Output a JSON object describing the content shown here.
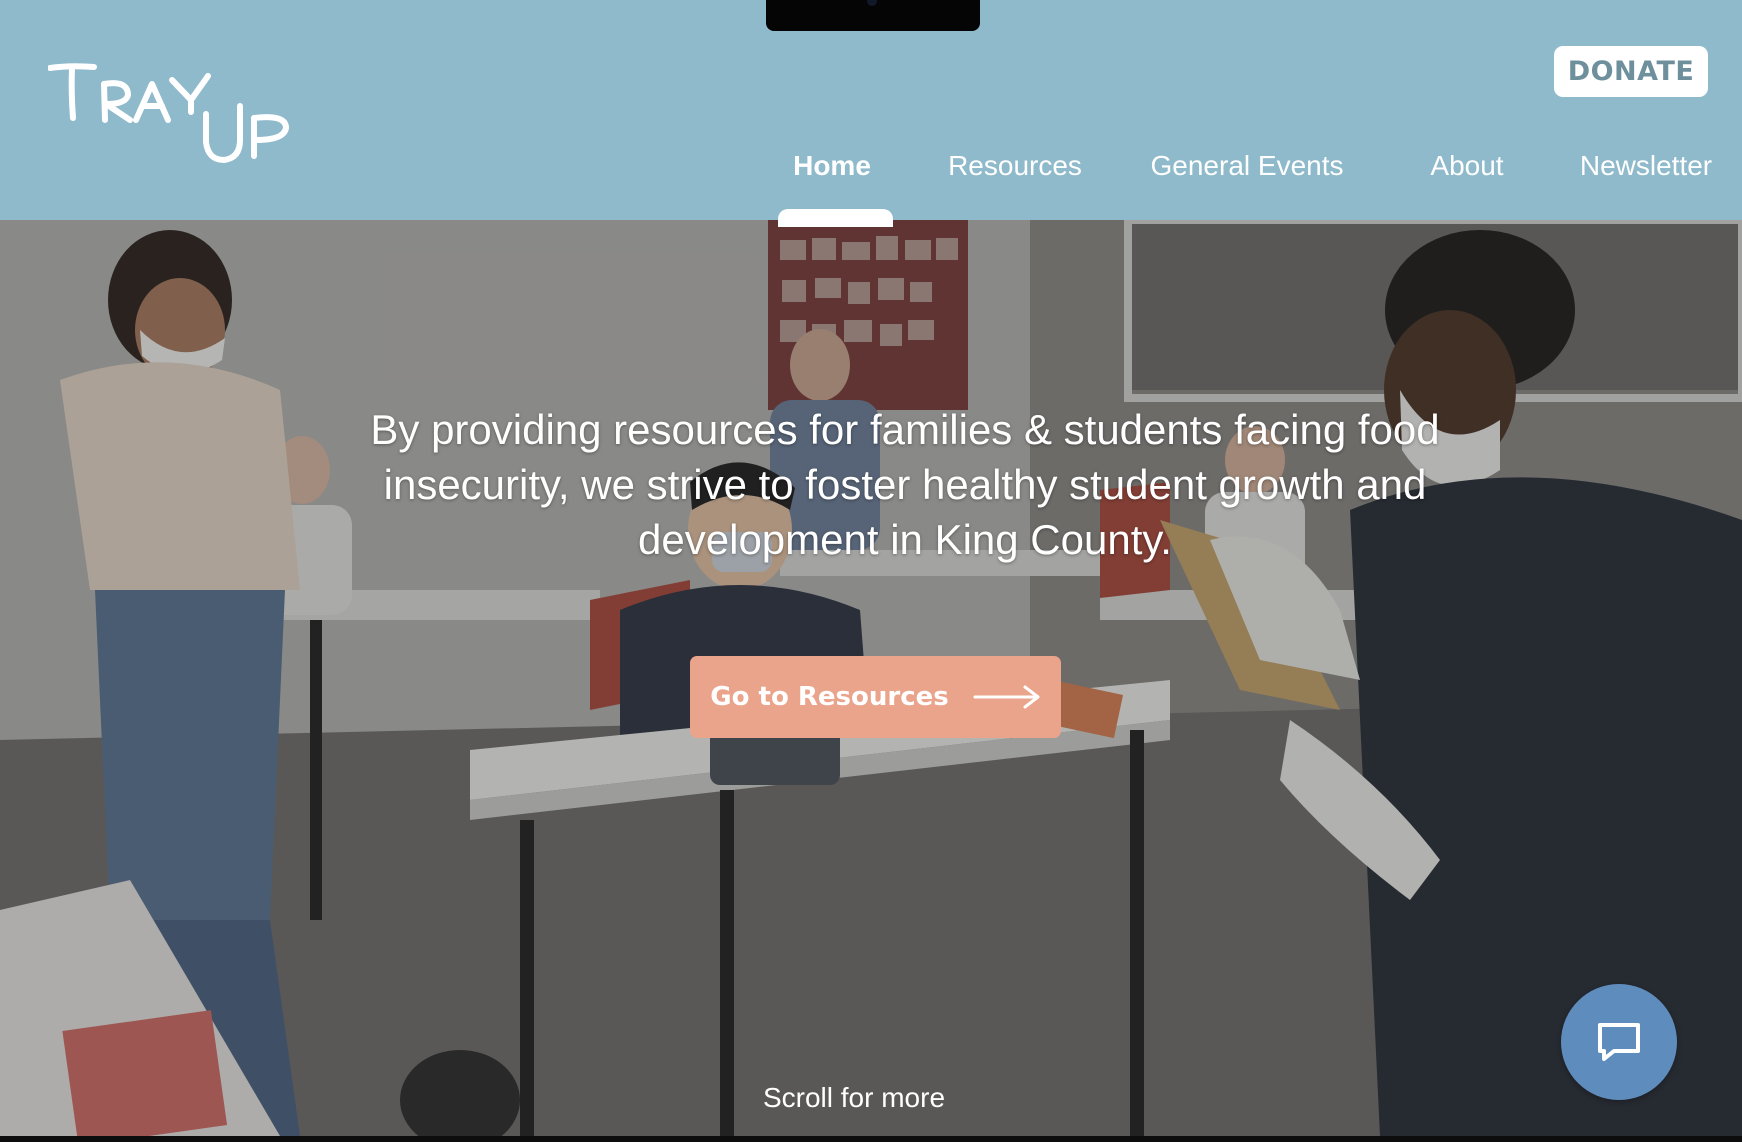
{
  "header": {
    "logo_text": "TRAY UP",
    "donate_label": "DONATE",
    "nav": [
      {
        "label": "Home",
        "active": true
      },
      {
        "label": "Resources",
        "active": false
      },
      {
        "label": "General Events",
        "active": false
      },
      {
        "label": "About",
        "active": false
      },
      {
        "label": "Newsletter",
        "active": false
      }
    ]
  },
  "hero": {
    "headline": "By providing resources for families & students facing food insecurity, we strive to foster healthy student growth and development in King County.",
    "cta_label": "Go to Resources",
    "cta_icon": "arrow-right-icon",
    "scroll_label": "Scroll for more",
    "background": "classroom-photo"
  },
  "chat": {
    "icon": "chat-bubble-icon"
  },
  "colors": {
    "header_bg": "#8fbacb",
    "donate_text": "#6e8f9c",
    "cta_bg": "#eaa48c",
    "chat_bg": "#5e8dbd"
  }
}
